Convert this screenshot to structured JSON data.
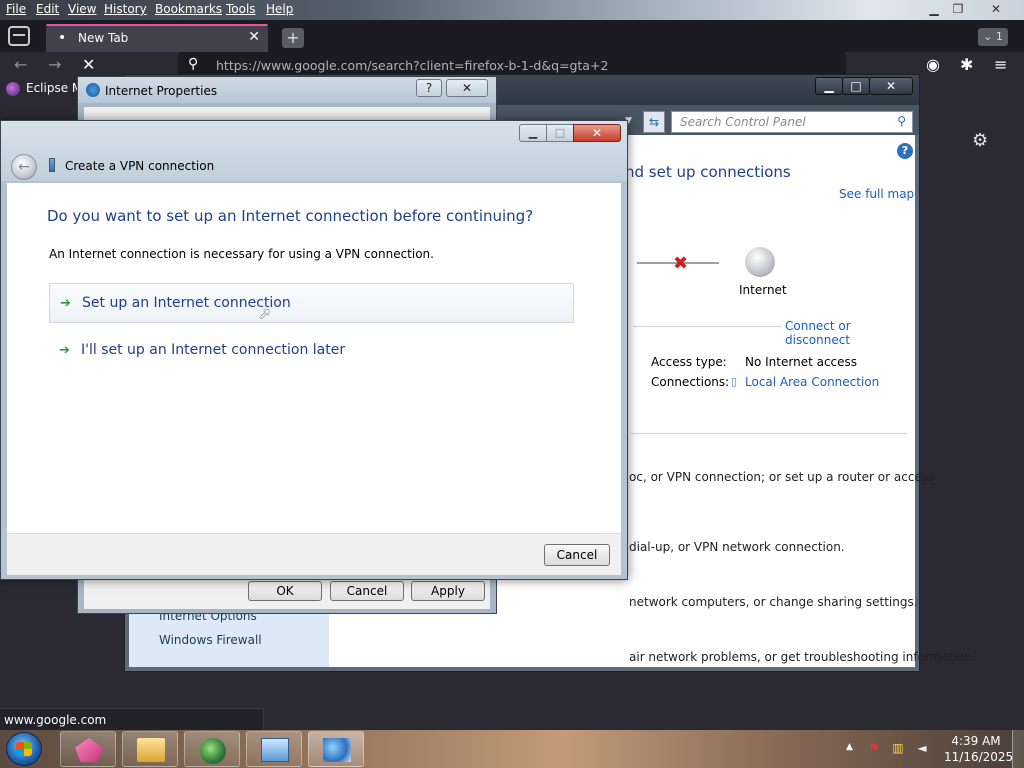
{
  "browser": {
    "menu": [
      "File",
      "Edit",
      "View",
      "History",
      "Bookmarks",
      "Tools",
      "Help"
    ],
    "tab_title": "New Tab",
    "tab_count": "1",
    "url": "https://www.google.com/search?client=firefox-b-1-d&q=gta+2",
    "bookmark": "Eclipse M",
    "status_url": "www.google.com"
  },
  "control_panel": {
    "search_placeholder": "Search Control Panel",
    "heading": "nd set up connections",
    "see_full_map": "See full map",
    "internet_label": "Internet",
    "connect_disconnect": "Connect or disconnect",
    "access_type_label": "Access type:",
    "access_type_value": "No Internet access",
    "connections_label": "Connections:",
    "connections_value": "Local Area Connection",
    "tasks": [
      "oc, or VPN connection; or set up a router or access",
      "dial-up, or VPN network connection.",
      "network computers, or change sharing settings.",
      "air network problems, or get troubleshooting information."
    ],
    "sidebar_links": [
      "Internet Options",
      "Windows Firewall"
    ]
  },
  "internet_properties": {
    "title": "Internet Properties",
    "help_btn": "?",
    "close_btn": "✕",
    "ok": "OK",
    "cancel": "Cancel",
    "apply": "Apply"
  },
  "vpn_wizard": {
    "title": "Create a VPN connection",
    "question": "Do you want to set up an Internet connection before continuing?",
    "description": "An Internet connection is necessary for using a VPN connection.",
    "option_setup": "Set up an Internet connection",
    "option_later": "I'll set up an Internet connection later",
    "cancel": "Cancel"
  },
  "taskbar": {
    "time": "4:39 AM",
    "date": "11/16/2025"
  },
  "colors": {
    "link_blue": "#1a5ec0",
    "heading_blue": "#1e3f8c",
    "green_arrow": "#2e9e3a",
    "error_red": "#d21e1e"
  }
}
